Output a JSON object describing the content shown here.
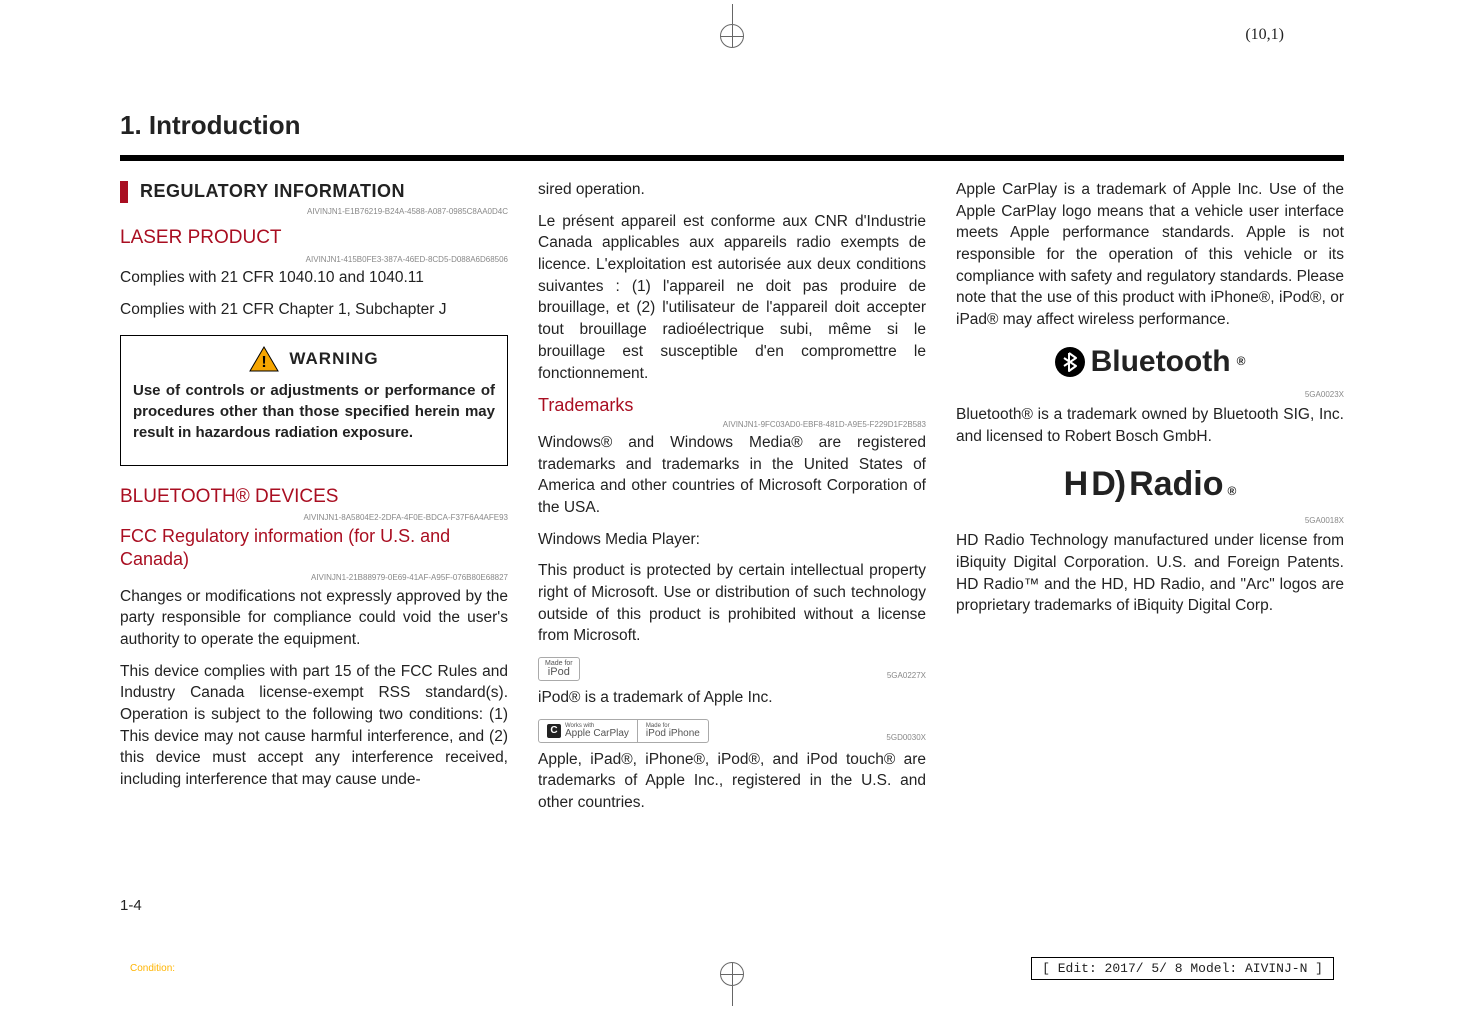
{
  "sheet_coord": "(10,1)",
  "chapter_title": "1. Introduction",
  "page_number": "1-4",
  "condition_label": "Condition:",
  "edit_stamp": "[ Edit: 2017/ 5/ 8   Model:  AIVINJ-N ]",
  "col1": {
    "reg_header": "REGULATORY INFORMATION",
    "code1": "AIVINJN1-E1B76219-B24A-4588-A087-0985C8AA0D4C",
    "laser_head": "LASER PRODUCT",
    "code2": "AIVINJN1-415B0FE3-387A-46ED-8CD5-D088A6D68506",
    "laser_p1": "Complies with 21 CFR 1040.10 and 1040.11",
    "laser_p2": "Complies with 21 CFR Chapter 1, Subchapter J",
    "warning_label": "WARNING",
    "warning_body": "Use of controls or adjustments or performance of procedures other than those specified herein may result in hazardous radiation exposure.",
    "bt_head": "BLUETOOTH® DEVICES",
    "code3": "AIVINJN1-8A5804E2-2DFA-4F0E-BDCA-F37F6A4AFE93",
    "fcc_head": "FCC Regulatory information (for U.S. and Canada)",
    "code4": "AIVINJN1-21B88979-0E69-41AF-A95F-076B80E68827",
    "fcc_p1": " Changes or modifications not expressly approved by the party responsible for compliance could void the user's authority to operate the equipment.",
    "fcc_p2": "This device complies with part 15 of the FCC Rules and Industry Canada license-exempt RSS standard(s). Operation is subject to the following two conditions: (1) This device may not cause harmful interference, and (2) this device must accept any interference received, including interference that may cause unde-"
  },
  "col2": {
    "cont1": "sired operation.",
    "fr": " Le présent appareil est conforme aux CNR d'Industrie Canada applicables aux appareils radio exempts de licence. L'exploitation est autorisée aux deux conditions suivantes : (1) l'appareil ne doit pas produire de brouillage, et (2) l'utilisateur de l'appareil doit accepter tout brouillage radioélectrique subi, même si le brouillage est susceptible d'en compromettre le fonctionnement.",
    "tm_head": "Trademarks",
    "code5": "AIVINJN1-9FC03AD0-EBF8-481D-A9E5-F229D1F2B583",
    "tm_p1": "Windows® and Windows Media® are registered trademarks and trademarks in the United States of America and other countries of Microsoft Corporation of the USA.",
    "tm_p2": "Windows Media Player:",
    "tm_p3": "This product is protected by certain intellectual property right of Microsoft. Use or distribution of such technology outside of this product is prohibited without a license from Microsoft.",
    "ipod_badge_small": "Made for",
    "ipod_badge_big": "iPod",
    "img_code1": "5GA0227X",
    "ipod_line": "iPod® is a trademark of Apple Inc.",
    "combo_c": "C",
    "combo_left_t": "Works with",
    "combo_left_b": "Apple CarPlay",
    "combo_right_t": "Made for",
    "combo_right_b": "iPod  iPhone",
    "img_code2": "5GD0030X",
    "apple_p": "Apple, iPad®, iPhone®, iPod®, and iPod touch® are trademarks of Apple Inc., registered in the U.S. and other countries."
  },
  "col3": {
    "carplay_p": "Apple CarPlay is a trademark of Apple Inc. Use of the Apple CarPlay logo means that a vehicle user interface meets Apple performance standards. Apple is not responsible for the operation of this vehicle or its compliance with safety and regulatory standards. Please note that the use of this product with iPhone®, iPod®, or iPad® may affect wireless performance.",
    "bt_logo_text": "Bluetooth",
    "bt_reg": "®",
    "img_code3": "5GA0023X",
    "bt_p": "Bluetooth® is a trademark owned by Bluetooth SIG, Inc. and licensed to Robert Bosch GmbH.",
    "hd_h": "H",
    "hd_d": "D)",
    "hd_radio": "Radio",
    "hd_reg": "®",
    "img_code4": "5GA0018X",
    "hd_p": "HD Radio Technology manufactured under license from iBiquity Digital Corporation. U.S. and Foreign Patents. HD Radio™ and the HD, HD Radio, and \"Arc\" logos are proprietary trademarks of iBiquity Digital Corp."
  }
}
